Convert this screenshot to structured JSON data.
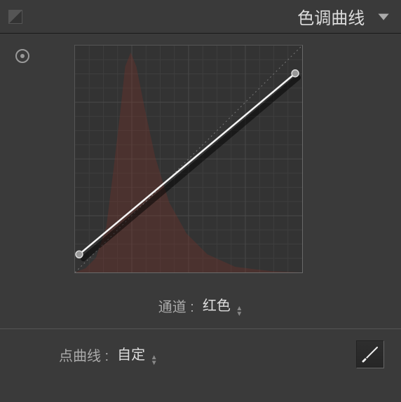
{
  "header": {
    "title": "色调曲线"
  },
  "channel": {
    "label": "通道 :",
    "value": "红色"
  },
  "pointCurve": {
    "label": "点曲线 :",
    "value": "自定"
  },
  "icons": {
    "collapse": "▼"
  }
}
